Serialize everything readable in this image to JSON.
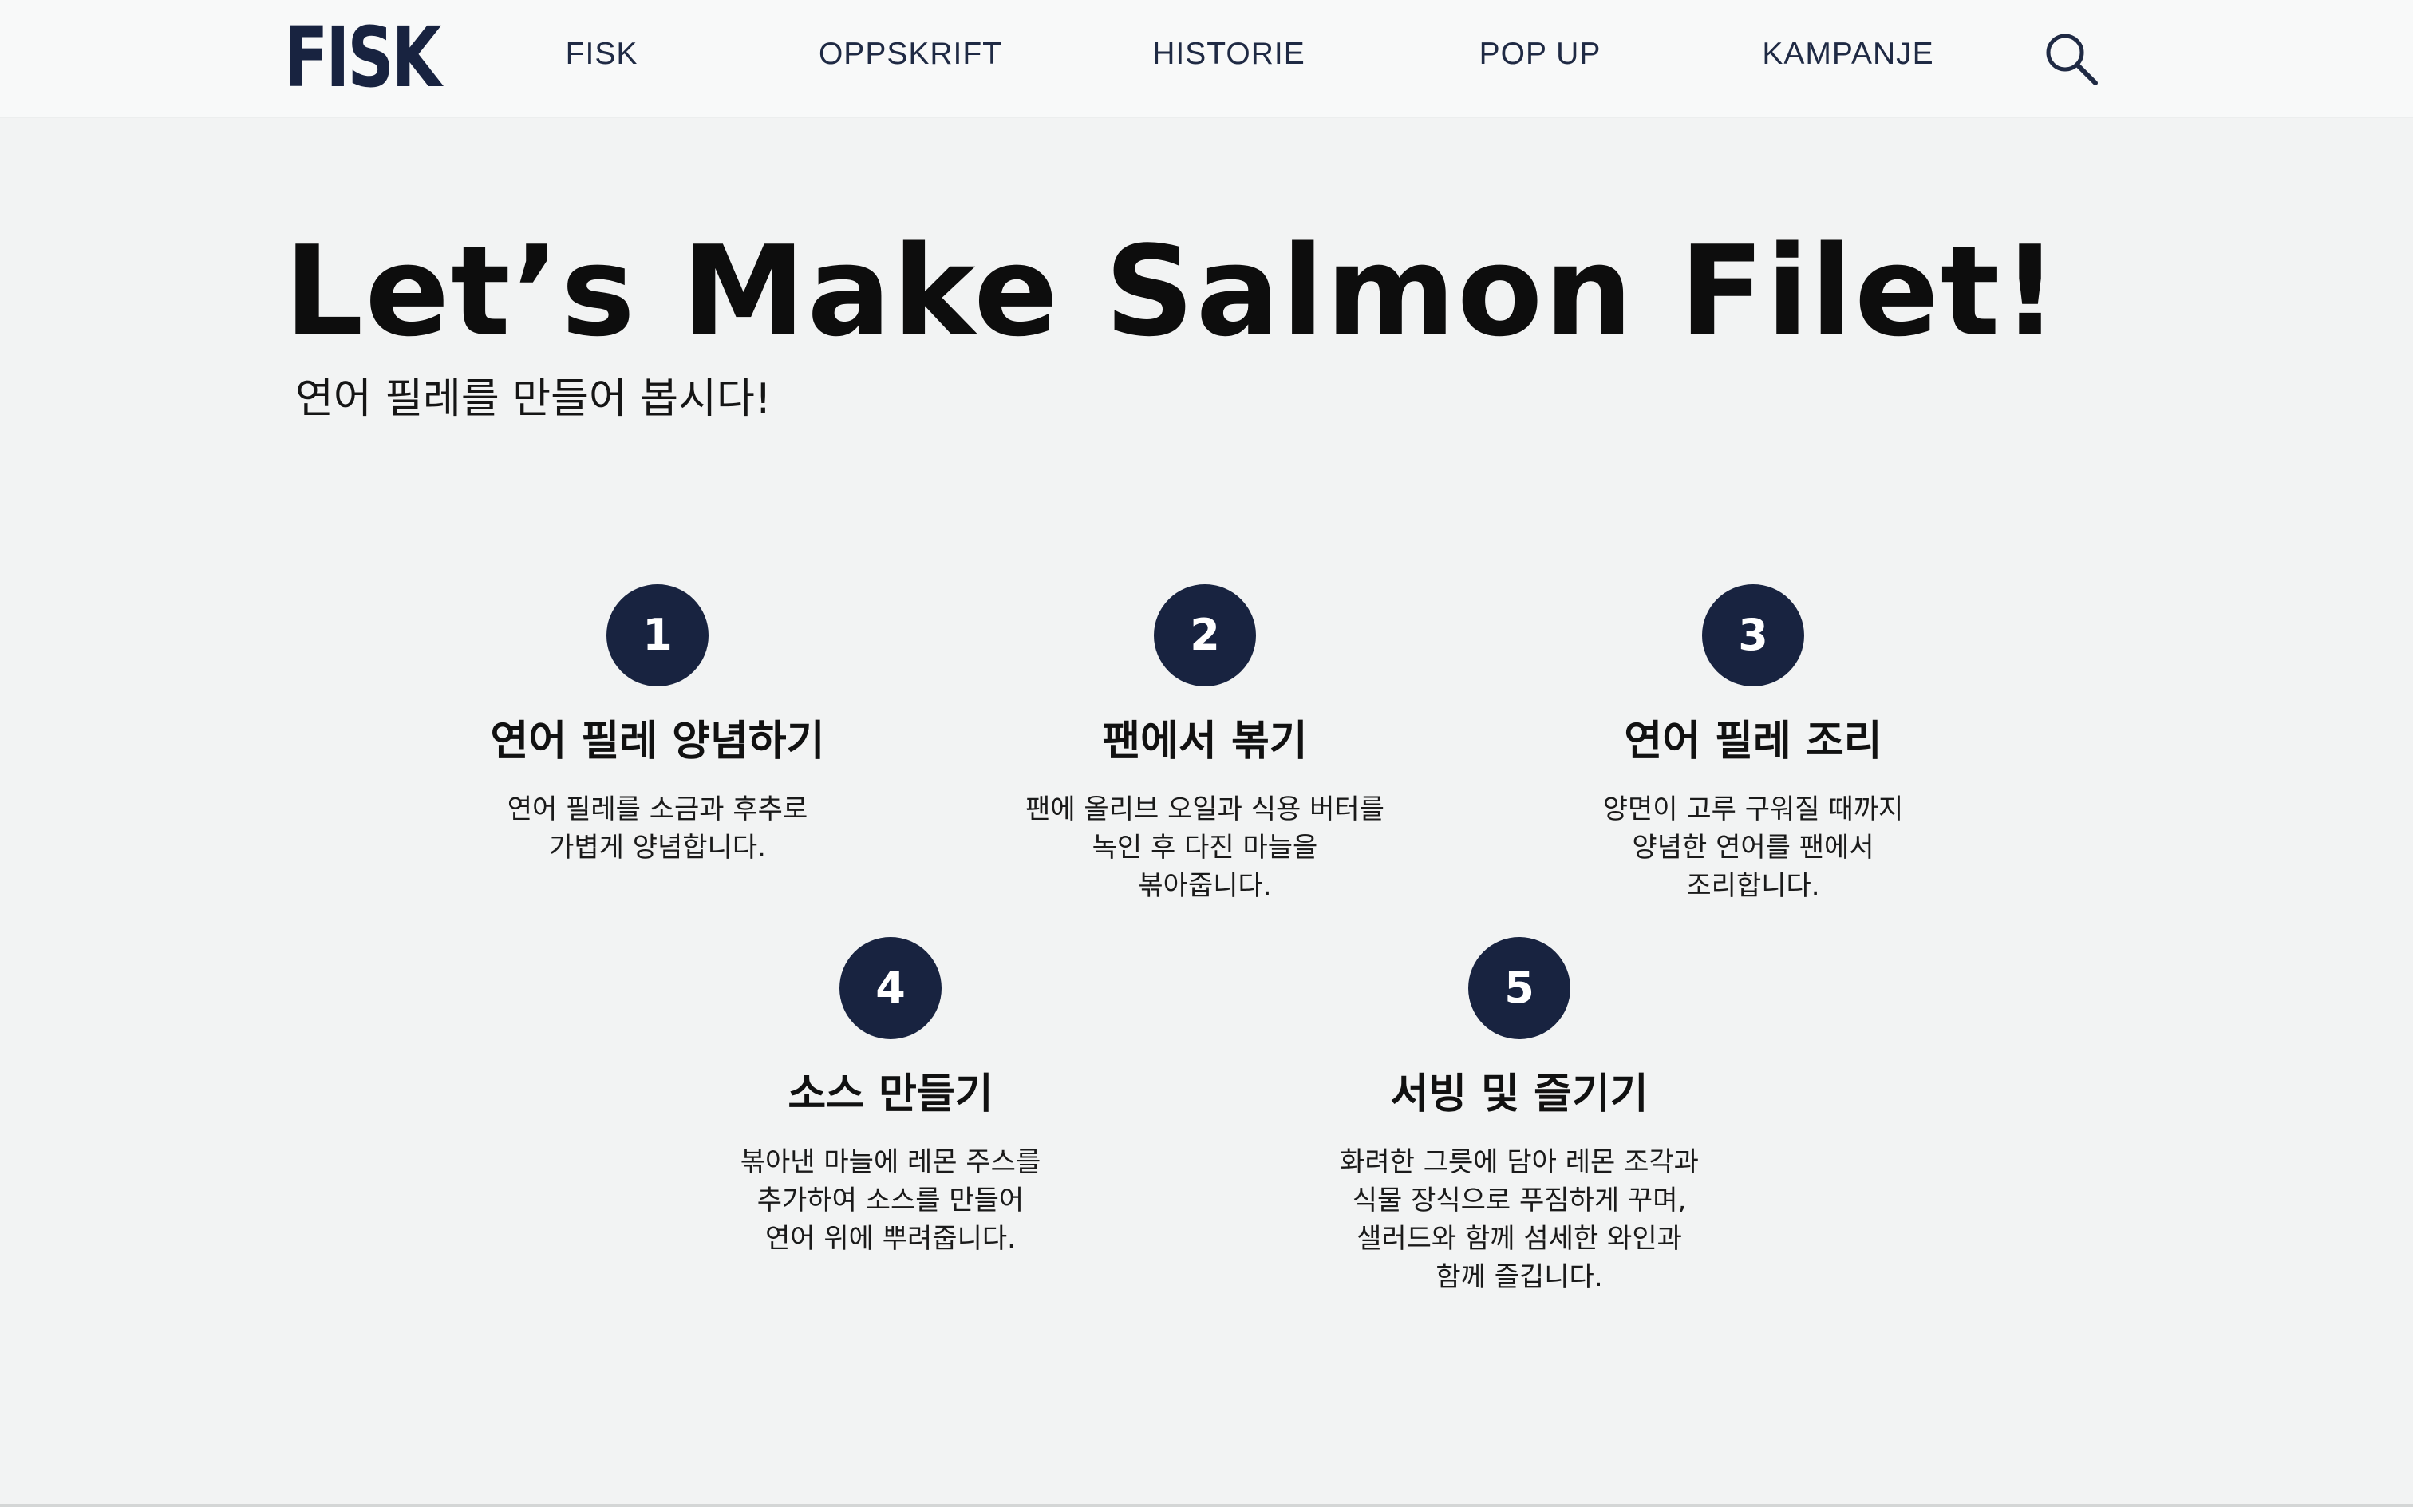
{
  "header": {
    "logo": "FISK",
    "nav": [
      {
        "label": "FISK"
      },
      {
        "label": "OPPSKRIFT"
      },
      {
        "label": "HISTORIE"
      },
      {
        "label": "POP UP"
      },
      {
        "label": "KAMPANJE"
      }
    ],
    "search_icon": "search-icon"
  },
  "hero": {
    "title": "Let’s Make Salmon Filet!",
    "subtitle": "연어 필레를 만들어 봅시다!"
  },
  "steps": [
    {
      "number": "1",
      "title": "연어 필레 양념하기",
      "lines": [
        "연어 필레를 소금과 후추로",
        "가볍게 양념합니다."
      ]
    },
    {
      "number": "2",
      "title": "팬에서 볶기",
      "lines": [
        "팬에 올리브 오일과 식용 버터를",
        "녹인 후 다진 마늘을",
        "볶아줍니다."
      ]
    },
    {
      "number": "3",
      "title": "연어 필레 조리",
      "lines": [
        "양면이 고루 구워질 때까지",
        "양념한 연어를 팬에서",
        "조리합니다."
      ]
    },
    {
      "number": "4",
      "title": "소스 만들기",
      "lines": [
        "볶아낸 마늘에 레몬 주스를",
        "추가하여 소스를 만들어",
        "연어 위에 뿌려줍니다."
      ]
    },
    {
      "number": "5",
      "title": "서빙 및 즐기기",
      "lines": [
        "화려한 그릇에 담아 레몬 조각과",
        "식물 장식으로 푸짐하게 꾸며,",
        "샐러드와 함께 섬세한 와인과",
        "함께 즐깁니다."
      ]
    }
  ],
  "colors": {
    "navy": "#182340",
    "background": "#f2f3f3",
    "header_bg": "#f8f9f9"
  }
}
